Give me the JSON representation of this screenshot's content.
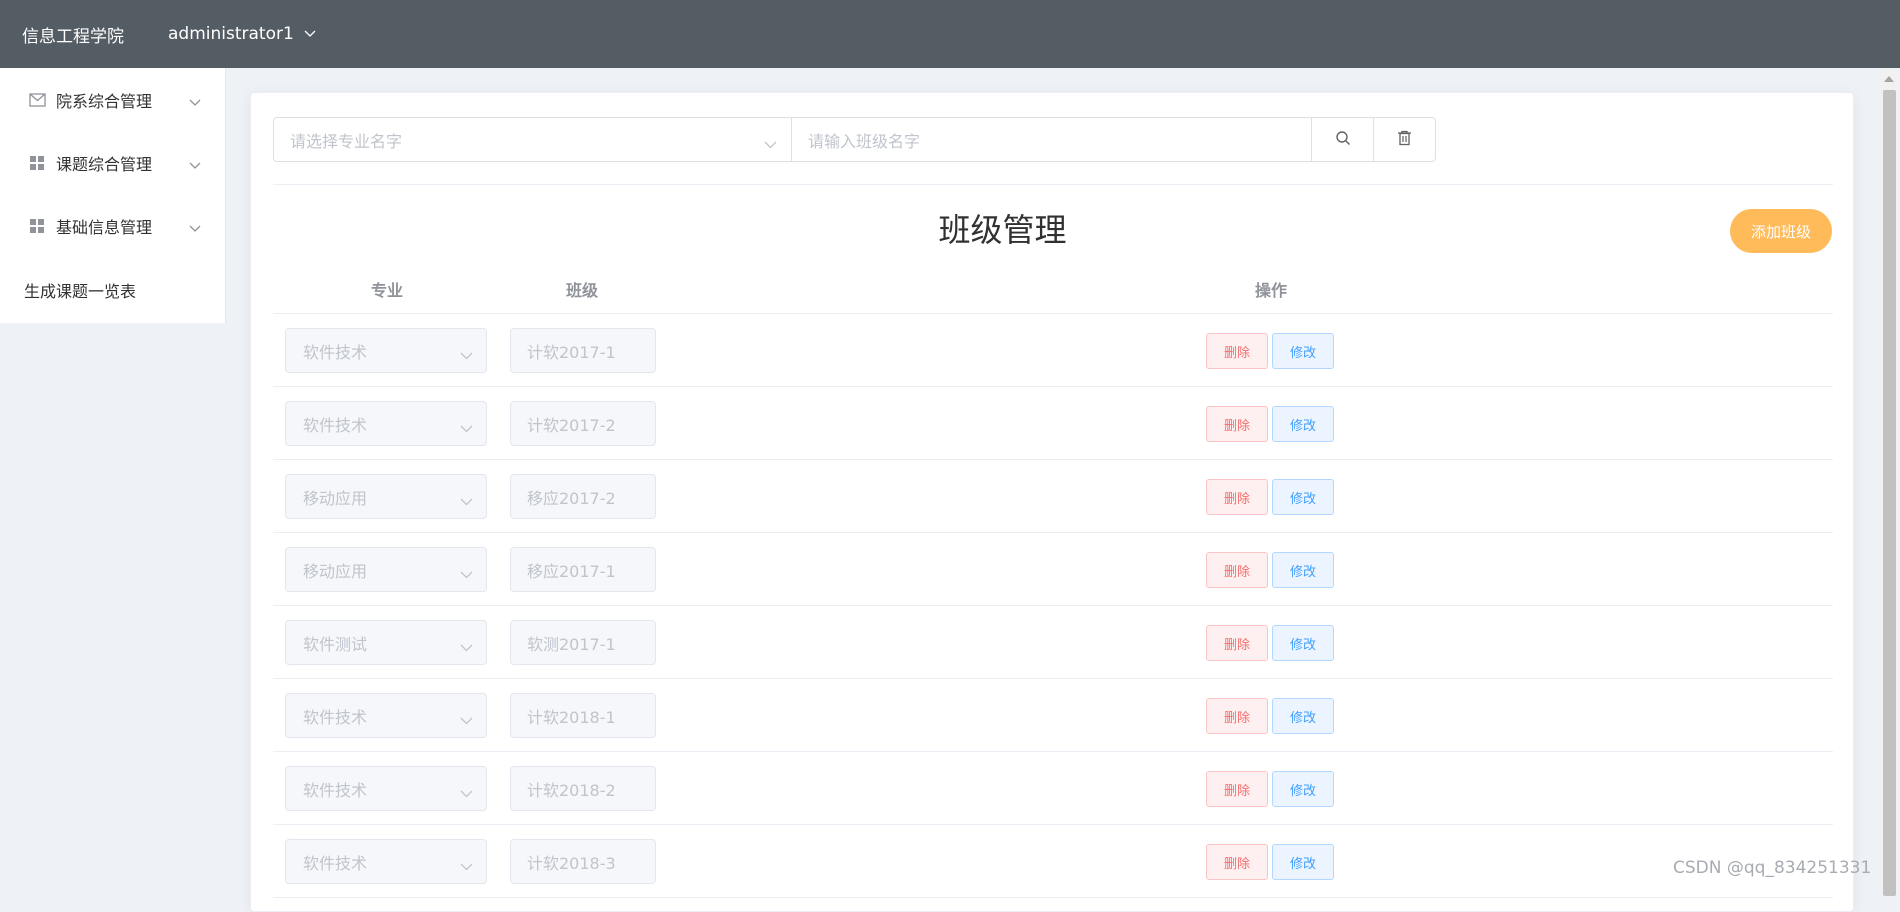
{
  "header": {
    "brand": "信息工程学院",
    "user": "administrator1"
  },
  "sidebar": {
    "items": [
      {
        "label": "院系综合管理",
        "icon": "message-icon"
      },
      {
        "label": "课题综合管理",
        "icon": "grid-icon"
      },
      {
        "label": "基础信息管理",
        "icon": "grid-icon"
      },
      {
        "label": "生成课题一览表"
      }
    ]
  },
  "search": {
    "major_placeholder": "请选择专业名字",
    "class_placeholder": "请输入班级名字"
  },
  "page": {
    "title": "班级管理",
    "add_button": "添加班级"
  },
  "table": {
    "columns": [
      "专业",
      "班级",
      "操作"
    ],
    "delete_label": "删除",
    "edit_label": "修改",
    "rows": [
      {
        "major": "软件技术",
        "class": "计软2017-1"
      },
      {
        "major": "软件技术",
        "class": "计软2017-2"
      },
      {
        "major": "移动应用",
        "class": "移应2017-2"
      },
      {
        "major": "移动应用",
        "class": "移应2017-1"
      },
      {
        "major": "软件测试",
        "class": "软测2017-1"
      },
      {
        "major": "软件技术",
        "class": "计软2018-1"
      },
      {
        "major": "软件技术",
        "class": "计软2018-2"
      },
      {
        "major": "软件技术",
        "class": "计软2018-3"
      }
    ]
  },
  "watermark": "CSDN @qq_834251331",
  "colors": {
    "header_bg": "#545c64",
    "add_button": "#ffba5a",
    "danger": "#f56c6c",
    "primary": "#409eff"
  }
}
